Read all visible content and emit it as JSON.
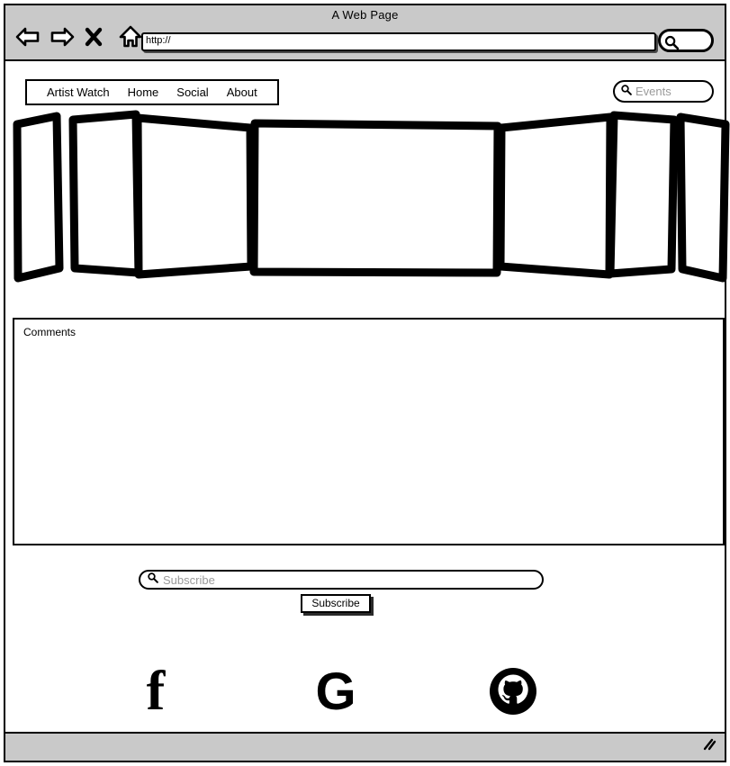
{
  "browser": {
    "window_title": "A Web Page",
    "address_value": "http://",
    "back_icon": "back-arrow-icon",
    "forward_icon": "forward-arrow-icon",
    "stop_icon": "close-x-icon",
    "home_icon": "home-icon",
    "search_icon": "search-icon"
  },
  "site_nav": {
    "items": [
      {
        "label": "Artist Watch"
      },
      {
        "label": "Home"
      },
      {
        "label": "Social"
      },
      {
        "label": "About"
      }
    ]
  },
  "events_search": {
    "placeholder": "Events",
    "icon": "search-icon"
  },
  "carousel": {
    "name": "cover-flow-carousel",
    "panel_count": 7,
    "active_index": 3
  },
  "comments": {
    "label": "Comments",
    "value": ""
  },
  "subscribe": {
    "placeholder": "Subscribe",
    "value": "",
    "icon": "search-icon",
    "button_label": "Subscribe"
  },
  "social": {
    "items": [
      {
        "name": "facebook-icon",
        "label": "f"
      },
      {
        "name": "google-icon",
        "label": "G"
      },
      {
        "name": "github-icon",
        "label": ""
      }
    ]
  },
  "status_bar": {
    "resize_grip": "resize-grip-icon"
  },
  "colors": {
    "chrome": "#c9c9c9",
    "ink": "#000000",
    "placeholder": "#9a9a9a",
    "page": "#ffffff"
  }
}
